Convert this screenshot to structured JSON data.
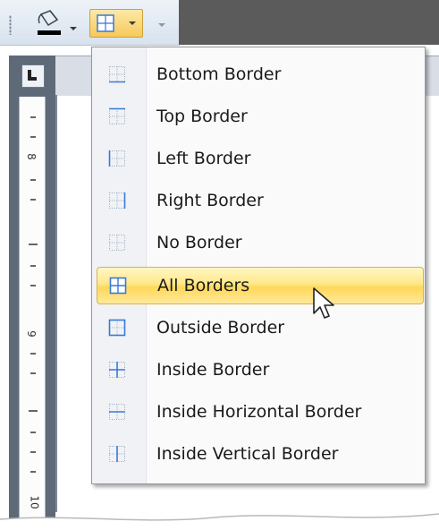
{
  "menu": {
    "items": [
      {
        "label": "Bottom Border",
        "icon": "bottom-border-icon"
      },
      {
        "label": "Top Border",
        "icon": "top-border-icon"
      },
      {
        "label": "Left Border",
        "icon": "left-border-icon"
      },
      {
        "label": "Right Border",
        "icon": "right-border-icon"
      },
      {
        "label": "No Border",
        "icon": "no-border-icon"
      },
      {
        "label": "All Borders",
        "icon": "all-borders-icon",
        "selected": true
      },
      {
        "label": "Outside Border",
        "icon": "outside-border-icon"
      },
      {
        "label": "Inside Border",
        "icon": "inside-border-icon"
      },
      {
        "label": "Inside Horizontal Border",
        "icon": "inside-horizontal-border-icon"
      },
      {
        "label": "Inside Vertical Border",
        "icon": "inside-vertical-border-icon"
      }
    ]
  },
  "ruler": {
    "numbers": [
      "8",
      "9",
      "10"
    ]
  },
  "colors": {
    "highlight": "#ffe88a",
    "border_blue": "#3a78d8",
    "dotted_gray": "#9aa8bc"
  }
}
